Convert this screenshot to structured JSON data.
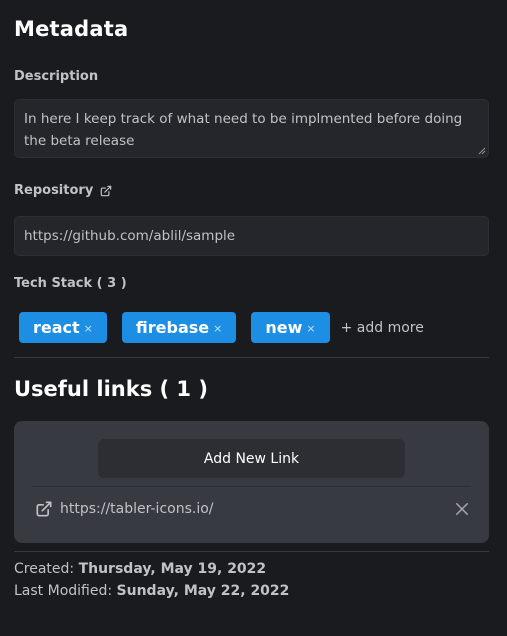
{
  "metadata": {
    "title": "Metadata",
    "description_label": "Description",
    "description_value": "In here I keep track of what need to be implmented before doing the beta release",
    "repository_label": "Repository",
    "repository_value": "https://github.com/ablil/sample",
    "tech_stack_label": "Tech Stack ( 3 )",
    "tags": [
      {
        "label": "react",
        "remove": "×"
      },
      {
        "label": "firebase",
        "remove": "×"
      },
      {
        "label": "new",
        "remove": "×"
      }
    ],
    "add_more": "+ add more"
  },
  "links": {
    "title": "Useful links ( 1 )",
    "add_button": "Add New Link",
    "items": [
      {
        "url": "https://tabler-icons.io/"
      }
    ]
  },
  "dates": {
    "created_label": "Created:",
    "created_value": "Thursday, May 19, 2022",
    "modified_label": "Last Modified:",
    "modified_value": "Sunday, May 22, 2022"
  },
  "icons": {
    "external_link": "external-link-icon",
    "close": "close-icon"
  },
  "colors": {
    "background": "#1a1b1e",
    "field": "#25262b",
    "tag": "#1c8fe4",
    "panel": "#373a40"
  }
}
